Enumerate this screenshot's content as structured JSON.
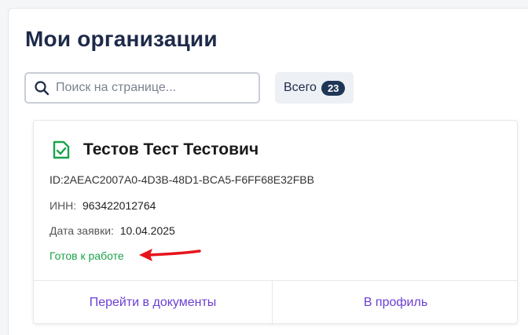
{
  "page": {
    "title": "Мои организации"
  },
  "search": {
    "placeholder": "Поиск на странице...",
    "icon": "search-icon"
  },
  "total": {
    "label": "Всего",
    "count": "23"
  },
  "organization": {
    "name": "Тестов Тест Тестович",
    "icon": "document-check-icon",
    "id_label": "ID:",
    "id_value": "2AEAC2007A0-4D3B-48D1-BCA5-F6FF68E32FBB",
    "inn_label": "ИНН:",
    "inn_value": "963422012764",
    "date_label": "Дата заявки:",
    "date_value": "10.04.2025",
    "status": "Готов к работе",
    "actions": {
      "documents": "Перейти в документы",
      "profile": "В профиль"
    }
  },
  "colors": {
    "title": "#1e2a4a",
    "status_green": "#1aa34a",
    "action_purple": "#6b3fd4",
    "badge_bg": "#1f3656",
    "annotation_arrow": "#e8141b"
  }
}
